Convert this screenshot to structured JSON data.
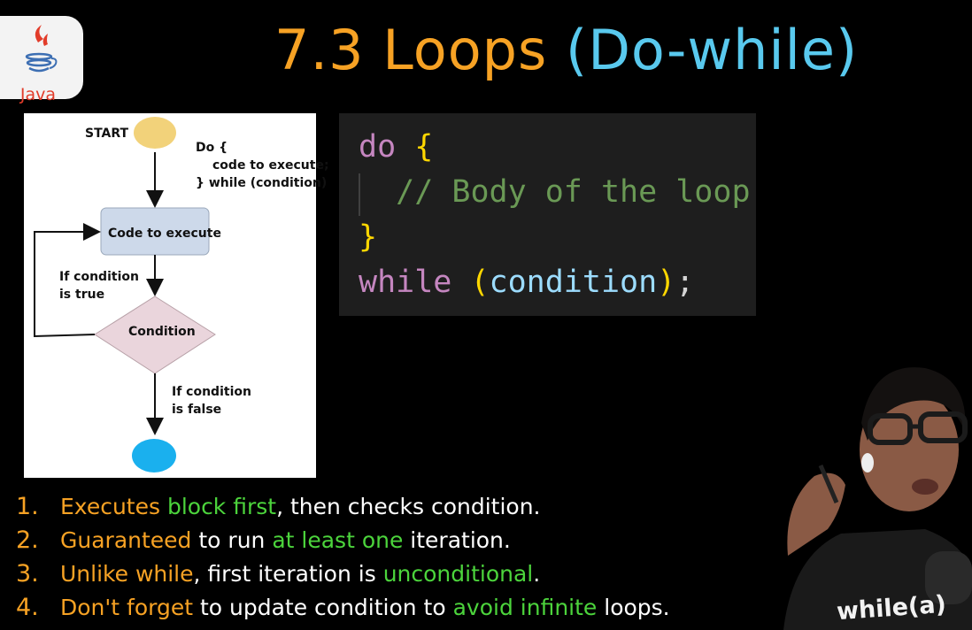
{
  "logo": {
    "text": "Java"
  },
  "title": {
    "main": "7.3 Loops ",
    "sub": "(Do-while)"
  },
  "flowchart": {
    "start_label": "START",
    "syntax_line1": "Do {",
    "syntax_line2": "code to execute;",
    "syntax_line3": "} while (condition)",
    "process_label": "Code to execute",
    "true_line1": "If condition",
    "true_line2": "is true",
    "decision_label": "Condition",
    "false_line1": "If condition",
    "false_line2": "is false",
    "colors": {
      "start": "#f2d27a",
      "end": "#1ab0ee",
      "process": "#cdd9ea",
      "decision": "#ead5dc"
    }
  },
  "code": {
    "line1_kw": "do",
    "line1_brace": "{",
    "line2_comment": "// Body of the loop",
    "line3_brace": "}",
    "line4_kw": "while",
    "line4_open": "(",
    "line4_ident": "condition",
    "line4_close": ")",
    "line4_semi": ";"
  },
  "points": [
    {
      "num": "1.",
      "p1": "Executes ",
      "p2": "block first",
      "p3": ", then checks condition.",
      "p4": "",
      "p5": ""
    },
    {
      "num": "2.",
      "p1": "Guaranteed",
      "p2": " to run ",
      "p3": "at least one",
      "p4": " iteration.",
      "p5": ""
    },
    {
      "num": "3.",
      "p1": "Unlike while",
      "p2": ", first iteration is ",
      "p3": "unconditional",
      "p4": ".",
      "p5": ""
    },
    {
      "num": "4.",
      "p1": "Don't forget",
      "p2": " to update condition to ",
      "p3": "avoid infinite",
      "p4": " loops.",
      "p5": ""
    }
  ],
  "presenter": {
    "shirt_text": "while(a)"
  },
  "colors": {
    "orange": "#f7a224",
    "green": "#4cd43c",
    "cyan": "#59c9ee"
  }
}
